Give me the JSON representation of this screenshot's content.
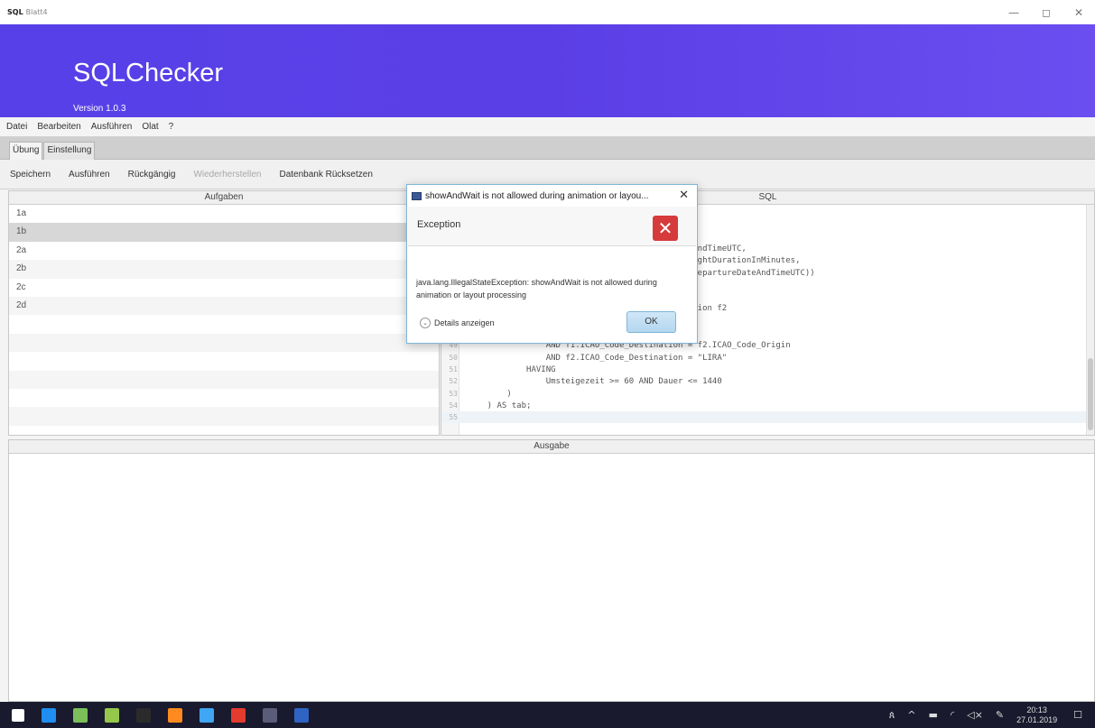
{
  "window": {
    "app_icon": "SQL",
    "title": "Blatt4",
    "min_icon": "minimize-icon",
    "max_icon": "maximize-icon",
    "close_icon": "close-icon"
  },
  "banner": {
    "app_title": "SQLChecker",
    "version": "Version 1.0.3",
    "color": "#5a40e8"
  },
  "menu": [
    "Datei",
    "Bearbeiten",
    "Ausführen",
    "Olat",
    "?"
  ],
  "tabs": [
    {
      "label": "Übung",
      "active": true
    },
    {
      "label": "Einstellung",
      "active": false
    }
  ],
  "toolbar": {
    "save": "Speichern",
    "run": "Ausführen",
    "undo": "Rückgängig",
    "redo": "Wiederherstellen",
    "reset_db": "Datenbank Rücksetzen"
  },
  "tasks": {
    "header": "Aufgaben",
    "items": [
      "1a",
      "1b",
      "2a",
      "2b",
      "2c",
      "2d"
    ],
    "selected": "1b"
  },
  "sql": {
    "header": "SQL",
    "lines": [
      {
        "n": "",
        "text": "                                    imeUTC"
      },
      {
        "n": "",
        "text": "                                    AndTimeUTC,"
      },
      {
        "n": "",
        "text": "                                    ,"
      },
      {
        "n": "",
        "text": "                                    artureDateAndTimeUTC,"
      },
      {
        "n": "",
        "text": "                                    UTE, f2.FlightDurationInMinutes,"
      },
      {
        "n": "",
        "text": "                                           f2.DepartureDateAndTimeUTC))"
      },
      {
        "n": "",
        "text": ""
      },
      {
        "n": "",
        "text": ""
      },
      {
        "n": "",
        "text": "                                    lightexecution f2"
      },
      {
        "n": "",
        "text": ""
      },
      {
        "n": "",
        "text": "                                  = \"EDDF\""
      },
      {
        "n": "49",
        "text": "                AND f1.ICAO_Code_Destination = f2.ICAO_Code_Origin"
      },
      {
        "n": "50",
        "text": "                AND f2.ICAO_Code_Destination = \"LIRA\""
      },
      {
        "n": "51",
        "text": "            HAVING"
      },
      {
        "n": "52",
        "text": "                Umsteigezeit >= 60 AND Dauer <= 1440"
      },
      {
        "n": "53",
        "text": "        )"
      },
      {
        "n": "54",
        "text": "    ) AS tab;"
      },
      {
        "n": "55",
        "text": ""
      }
    ]
  },
  "output": {
    "header": "Ausgabe"
  },
  "dialog": {
    "title": "showAndWait is not allowed during animation or layou...",
    "close_icon": "close-icon",
    "header": "Exception",
    "error_icon": "error-icon",
    "message": "java.lang.IllegalStateException: showAndWait is not allowed during animation or layout processing",
    "details": "Details anzeigen",
    "ok": "OK"
  },
  "taskbar": {
    "icons": [
      {
        "name": "windows-start-icon",
        "color": "#ffffff"
      },
      {
        "name": "edge-icon",
        "color": "#1f8ef0"
      },
      {
        "name": "task-view-icon",
        "color": "#7cbf5a"
      },
      {
        "name": "notepad-icon",
        "color": "#95c84a"
      },
      {
        "name": "terminal-icon",
        "color": "#2b2b2b"
      },
      {
        "name": "firefox-icon",
        "color": "#ff8a1f"
      },
      {
        "name": "file-explorer-icon",
        "color": "#3ea6f2"
      },
      {
        "name": "acrobat-icon",
        "color": "#e33b2e"
      },
      {
        "name": "sql-app-icon",
        "color": "#5b5b7a"
      },
      {
        "name": "word-icon",
        "color": "#2f64c2"
      }
    ],
    "time": "20:13",
    "date": "27.01.2019"
  }
}
